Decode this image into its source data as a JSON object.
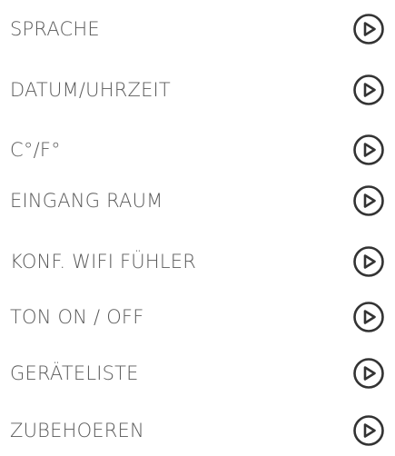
{
  "menu": {
    "items": [
      {
        "label": "SPRACHE",
        "icon": "play-circle-icon"
      },
      {
        "label": "DATUM/UHRZEIT",
        "icon": "play-circle-icon"
      },
      {
        "label": "C°/F°",
        "icon": "play-circle-icon"
      },
      {
        "label": "EINGANG RAUM",
        "icon": "play-circle-icon"
      },
      {
        "label": "KONF. WIFI FÜHLER",
        "icon": "play-circle-icon"
      },
      {
        "label": "TON ON / OFF",
        "icon": "play-circle-icon"
      },
      {
        "label": "GERÄTELISTE",
        "icon": "play-circle-icon"
      },
      {
        "label": "ZUBEHOEREN",
        "icon": "play-circle-icon"
      }
    ]
  },
  "colors": {
    "text": "#5a5a5a",
    "icon": "#333333",
    "background": "#ffffff"
  }
}
